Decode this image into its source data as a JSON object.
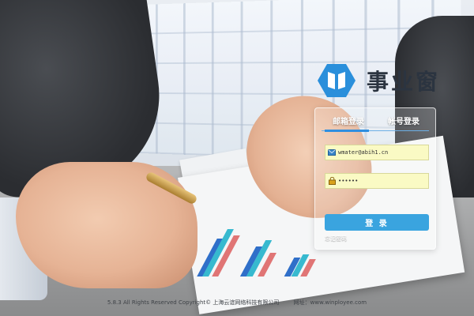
{
  "brand": {
    "name": "事业窗",
    "accent": "#2a8fdb"
  },
  "login": {
    "tabs": [
      {
        "label": "邮箱登录",
        "active": true
      },
      {
        "label": "帐号登录",
        "active": false
      }
    ],
    "email": {
      "value": "wmater@abih1.cn",
      "icon": "mail-icon"
    },
    "password": {
      "value": "••••••",
      "icon": "lock-icon"
    },
    "submit_label": "登 录",
    "forgot_label": "忘记密码",
    "field_bg": "#fafac4",
    "button_color": "#3aa4df"
  },
  "footer": {
    "version_copyright": "5.8.3  All Rights Reserved Copyright© 上海云谊网络科技有限公司",
    "website": "网址：www.winployee.com"
  }
}
